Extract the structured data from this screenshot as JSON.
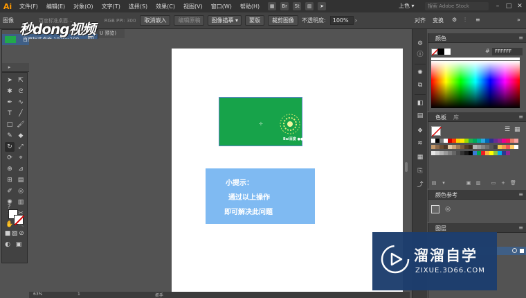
{
  "app": {
    "logo": "Ai"
  },
  "menu": {
    "items": [
      "文件(F)",
      "编辑(E)",
      "对象(O)",
      "文字(T)",
      "选择(S)",
      "效果(C)",
      "视图(V)",
      "窗口(W)",
      "帮助(H)"
    ],
    "br_label": "Br",
    "st_label": "St"
  },
  "workspace": {
    "label": "上色 ▾"
  },
  "stock_search": {
    "placeholder": "搜索 Adobe Stock"
  },
  "control_bar": {
    "label_image": "图像",
    "file_name": "百度标准桌面...",
    "color_mode": "RGB  PPI: 300",
    "embed_button": "取消嵌入",
    "edit_original_button": "编辑原稿",
    "image_trace_select": "图像描摹",
    "mask_button": "蒙版",
    "crop_button": "裁剪图像",
    "opacity_label": "不透明度:",
    "opacity_value": "100%",
    "align_label": "对齐",
    "transform_label": "变换"
  },
  "watermark_top": "秒dong视频",
  "links_panel": {
    "item_name": "百度标准桌面 1920×108...",
    "status_icon": "⧉"
  },
  "doc_tab": {
    "label": "U 预览)"
  },
  "canvas": {
    "image_logo_text": "Bai百度 ●●●",
    "tip_lines": [
      "小提示：",
      "通过以上操作",
      "即可解决此问题"
    ]
  },
  "status_bar": {
    "zoom": "63%",
    "page": "1",
    "tool": "抓手"
  },
  "color_panel": {
    "title": "颜色",
    "hex_value": "FFFFFF"
  },
  "swatches_panel": {
    "title": "色板",
    "tab_library": "库"
  },
  "guide_panel": {
    "title": "颜色参考"
  },
  "layers_panel": {
    "title": "图层"
  },
  "brand": {
    "name": "溜溜自学",
    "url": "ZIXUE.3D66.COM"
  },
  "colors": {
    "ui_dark": "#323232",
    "ui_mid": "#424242",
    "canvas_bg": "#535353",
    "image_green": "#17a34a",
    "tip_blue": "#7fbaf2",
    "brand_navy": "#1d3e6e",
    "selection_blue": "#3f5f86"
  },
  "swatch_colors": [
    "#ffffff",
    "#000000",
    "#7a7a7a",
    "#ffffff",
    "#d40000",
    "#ff3d00",
    "#ffcf00",
    "#ffe600",
    "#9cd900",
    "#23b14d",
    "#00a85a",
    "#00a99d",
    "#2aa6df",
    "#0068b4",
    "#2e3192",
    "#662d91",
    "#92278f",
    "#ec008c",
    "#ee145b",
    "#e87e6c",
    "#f6a2a2",
    "#c49a6c",
    "#8b6a4c",
    "#6b4f35",
    "#4e3a2a",
    "#e3c8a5",
    "#caa57c",
    "#a27b55",
    "#7a5a3d",
    "#543c27",
    "#3a2a1c",
    "#b5b5b5",
    "#9e9e9e",
    "#868686",
    "#6e6e6e",
    "#575757",
    "#404040",
    "#f2c94c",
    "#f2994a",
    "#eb5757",
    "#ffcc66",
    "#ffffff",
    "#e6e6e6",
    "#cccccc",
    "#b3b3b3",
    "#999999",
    "#808080",
    "#666666",
    "#4d4d4d",
    "#333333",
    "#1a1a1a",
    "#000000",
    "#3a7bd5",
    "#00a651",
    "#ed1c24",
    "#fbb040",
    "#ffff00",
    "#8dc63f",
    "#00aeef",
    "#2b3990",
    "#92278f"
  ]
}
